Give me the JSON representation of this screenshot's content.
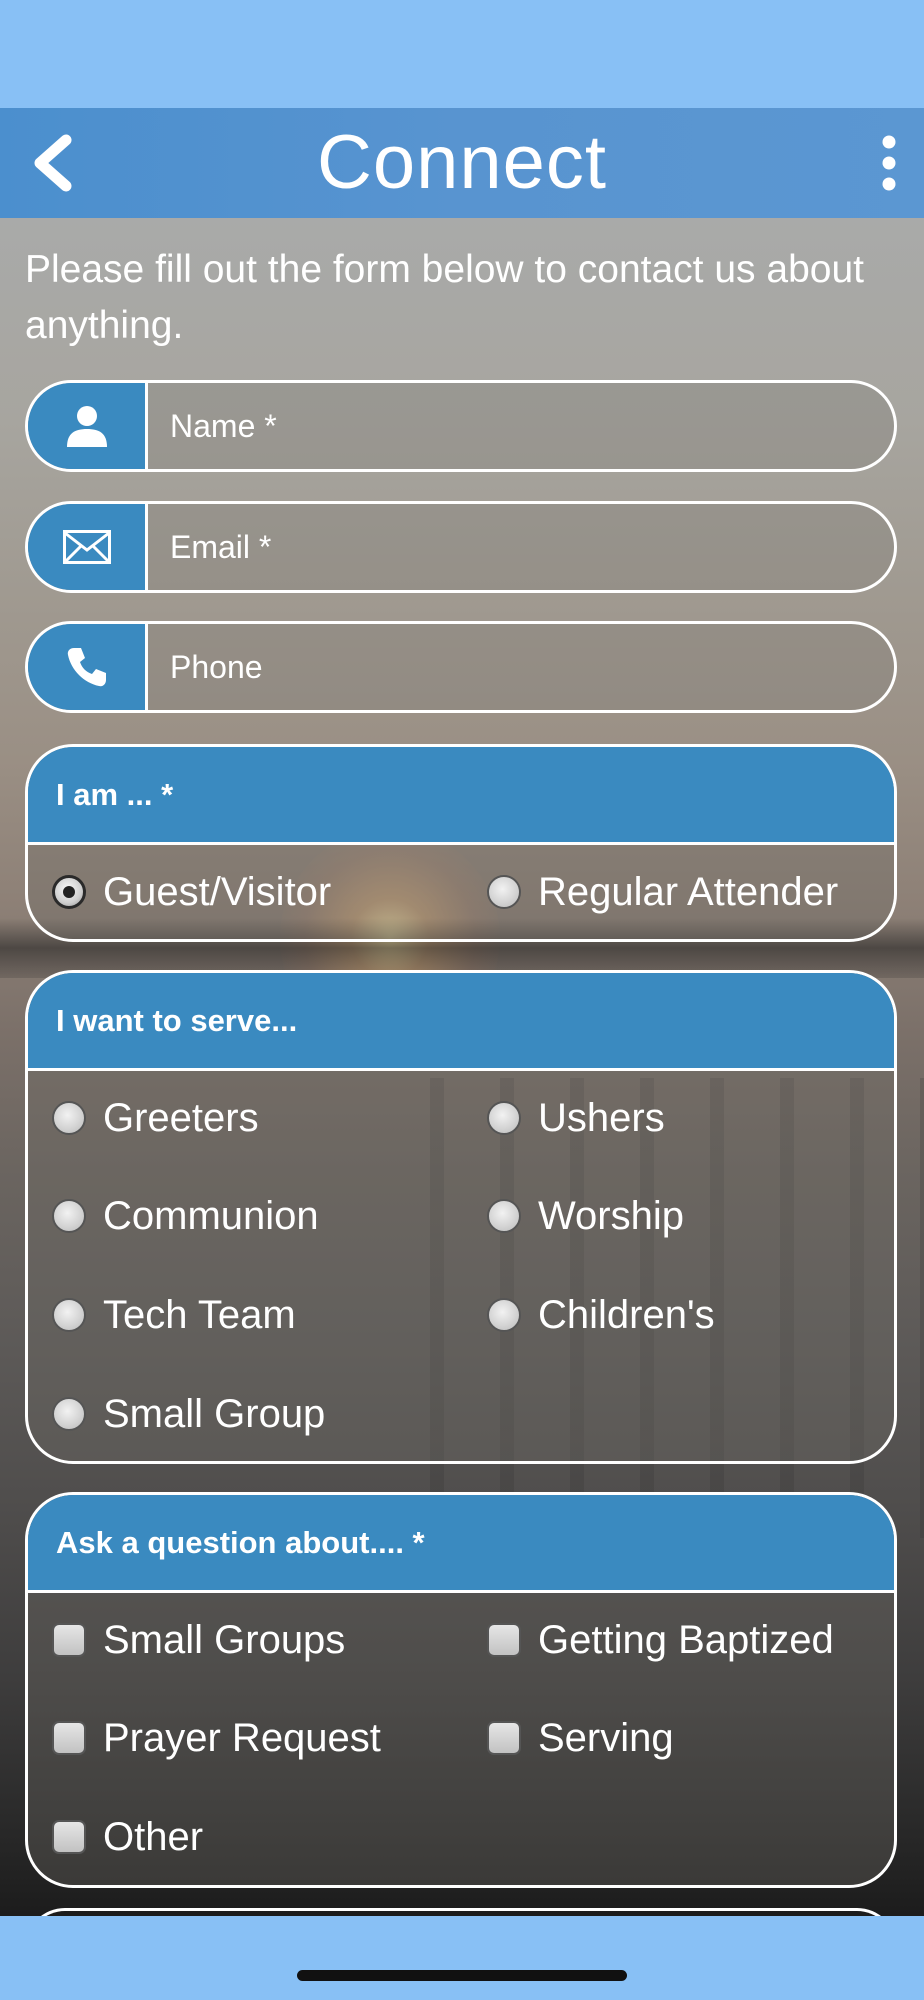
{
  "nav": {
    "title": "Connect"
  },
  "intro_text": "Please fill out the form below to contact us about anything.",
  "fields": {
    "name": {
      "placeholder": "Name *",
      "icon": "user-icon"
    },
    "email": {
      "placeholder": "Email *",
      "icon": "envelope-icon"
    },
    "phone": {
      "placeholder": "Phone",
      "icon": "phone-icon"
    }
  },
  "i_am": {
    "title": "I am ... *",
    "options": [
      "Guest/Visitor",
      "Regular Attender"
    ],
    "selected": "Guest/Visitor"
  },
  "serve": {
    "title": "I want to serve...",
    "options": [
      "Greeters",
      "Ushers",
      "Communion",
      "Worship",
      "Tech Team",
      "Children's",
      "Small Group"
    ]
  },
  "ask": {
    "title": "Ask a question about.... *",
    "options": [
      "Small Groups",
      "Getting Baptized",
      "Prayer Request",
      "Serving",
      "Other"
    ]
  },
  "colors": {
    "nav": "#5894d0",
    "header": "#3a8ac0",
    "system_bar": "#88c0f5"
  }
}
